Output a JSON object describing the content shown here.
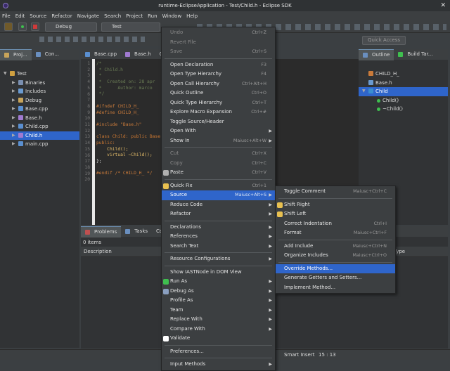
{
  "window": {
    "title": "runtime-EclipseApplication - Test/Child.h - Eclipse SDK"
  },
  "menubar": [
    "File",
    "Edit",
    "Source",
    "Refactor",
    "Navigate",
    "Search",
    "Project",
    "Run",
    "Window",
    "Help"
  ],
  "toolbar": {
    "debug_combo": "Debug",
    "test_combo": "Test",
    "quick_access": "Quick Access"
  },
  "project_explorer": {
    "tabs": [
      "Proj...",
      "Con..."
    ],
    "items": [
      {
        "label": "Test",
        "expanded": true
      },
      {
        "label": "Binaries"
      },
      {
        "label": "Includes"
      },
      {
        "label": "Debug"
      },
      {
        "label": "Base.cpp"
      },
      {
        "label": "Base.h"
      },
      {
        "label": "Child.cpp"
      },
      {
        "label": "Child.h",
        "selected": true
      },
      {
        "label": "main.cpp"
      }
    ]
  },
  "editor": {
    "tabs": [
      "Base.cpp",
      "Base.h",
      "C"
    ],
    "line_numbers": [
      "1",
      "2",
      "3",
      "4",
      "5",
      "6",
      "7",
      "8",
      "9",
      "10",
      "11",
      "12",
      "13",
      "14",
      "15",
      "16",
      "17",
      "18",
      "19",
      "20"
    ],
    "lines": [
      {
        "cls": "cm",
        "text": "/*"
      },
      {
        "cls": "cm",
        "text": " * Child.h"
      },
      {
        "cls": "cm",
        "text": " *"
      },
      {
        "cls": "cm",
        "text": " *  Created on: 28 apr"
      },
      {
        "cls": "cm",
        "text": " *      Author: marco"
      },
      {
        "cls": "cm",
        "text": " */"
      },
      {
        "cls": "",
        "text": ""
      },
      {
        "cls": "pp",
        "text": "#ifndef CHILD_H_"
      },
      {
        "cls": "pp",
        "text": "#define CHILD_H_"
      },
      {
        "cls": "",
        "text": ""
      },
      {
        "cls": "pp",
        "text": "#include \"Base.h\""
      },
      {
        "cls": "",
        "text": ""
      },
      {
        "cls": "kw",
        "text": "class Child: public Base"
      },
      {
        "cls": "kw",
        "text": "public:"
      },
      {
        "cls": "idf",
        "text": "    Child();"
      },
      {
        "cls": "idf",
        "text": "    virtual ~Child();"
      },
      {
        "cls": "",
        "text": "};"
      },
      {
        "cls": "",
        "text": ""
      },
      {
        "cls": "pp",
        "text": "#endif /* CHILD_H_ */"
      },
      {
        "cls": "",
        "text": ""
      }
    ]
  },
  "bottom_panel": {
    "tabs": [
      "Problems",
      "Tasks",
      "Con"
    ],
    "items_count": "0 items",
    "columns": [
      "Description",
      "Type"
    ]
  },
  "outline": {
    "tabs": [
      "Outline",
      "Build Tar..."
    ],
    "items": [
      {
        "label": "CHILD_H_"
      },
      {
        "label": "Base.h"
      },
      {
        "label": "Child",
        "selected": true
      },
      {
        "label": "Child()"
      },
      {
        "label": "~Child()"
      }
    ]
  },
  "context_menu": {
    "items": [
      {
        "label": "Undo",
        "shortcut": "Ctrl+Z",
        "disabled": true
      },
      {
        "label": "Revert File",
        "disabled": true
      },
      {
        "label": "Save",
        "shortcut": "Ctrl+S",
        "disabled": true
      },
      {
        "sep": true
      },
      {
        "label": "Open Declaration",
        "shortcut": "F3"
      },
      {
        "label": "Open Type Hierarchy",
        "shortcut": "F4"
      },
      {
        "label": "Open Call Hierarchy",
        "shortcut": "Ctrl+Alt+H"
      },
      {
        "label": "Quick Outline",
        "shortcut": "Ctrl+O"
      },
      {
        "label": "Quick Type Hierarchy",
        "shortcut": "Ctrl+T"
      },
      {
        "label": "Explore Macro Expansion",
        "shortcut": "Ctrl+#"
      },
      {
        "label": "Toggle Source/Header"
      },
      {
        "label": "Open With",
        "submenu": true
      },
      {
        "label": "Show In",
        "shortcut": "Maiusc+Alt+W",
        "submenu": true
      },
      {
        "sep": true
      },
      {
        "label": "Cut",
        "shortcut": "Ctrl+X",
        "disabled": true
      },
      {
        "label": "Copy",
        "shortcut": "Ctrl+C",
        "disabled": true
      },
      {
        "label": "Paste",
        "shortcut": "Ctrl+V"
      },
      {
        "sep": true
      },
      {
        "label": "Quick Fix",
        "shortcut": "Ctrl+1"
      },
      {
        "label": "Source",
        "shortcut": "Maiusc+Alt+S",
        "submenu": true,
        "highlighted": true
      },
      {
        "label": "Reduce Code",
        "submenu": true
      },
      {
        "label": "Refactor",
        "submenu": true
      },
      {
        "sep": true
      },
      {
        "label": "Declarations",
        "submenu": true
      },
      {
        "label": "References",
        "submenu": true
      },
      {
        "label": "Search Text",
        "submenu": true
      },
      {
        "sep": true
      },
      {
        "label": "Resource Configurations",
        "submenu": true
      },
      {
        "sep": true
      },
      {
        "label": "Show IASTNode in DOM View"
      },
      {
        "label": "Run As",
        "submenu": true
      },
      {
        "label": "Debug As",
        "submenu": true
      },
      {
        "label": "Profile As",
        "submenu": true
      },
      {
        "label": "Team",
        "submenu": true
      },
      {
        "label": "Replace With",
        "submenu": true
      },
      {
        "label": "Compare With",
        "submenu": true
      },
      {
        "label": "Validate"
      },
      {
        "sep": true
      },
      {
        "label": "Preferences..."
      },
      {
        "sep": true
      },
      {
        "label": "Input Methods",
        "submenu": true
      }
    ]
  },
  "source_submenu": {
    "items": [
      {
        "label": "Toggle Comment",
        "shortcut": "Maiusc+Ctrl+C"
      },
      {
        "sep": true
      },
      {
        "label": "Shift Right"
      },
      {
        "label": "Shift Left"
      },
      {
        "label": "Correct Indentation",
        "shortcut": "Ctrl+I"
      },
      {
        "label": "Format",
        "shortcut": "Maiusc+Ctrl+F"
      },
      {
        "sep": true
      },
      {
        "label": "Add Include",
        "shortcut": "Maiusc+Ctrl+N"
      },
      {
        "label": "Organize Includes",
        "shortcut": "Maiusc+Ctrl+O"
      },
      {
        "sep": true
      },
      {
        "label": "Override Methods...",
        "highlighted": true
      },
      {
        "label": "Generate Getters and Setters..."
      },
      {
        "label": "Implement Method..."
      }
    ]
  },
  "status": {
    "insert_mode": "Smart Insert",
    "position": "15 : 13"
  }
}
